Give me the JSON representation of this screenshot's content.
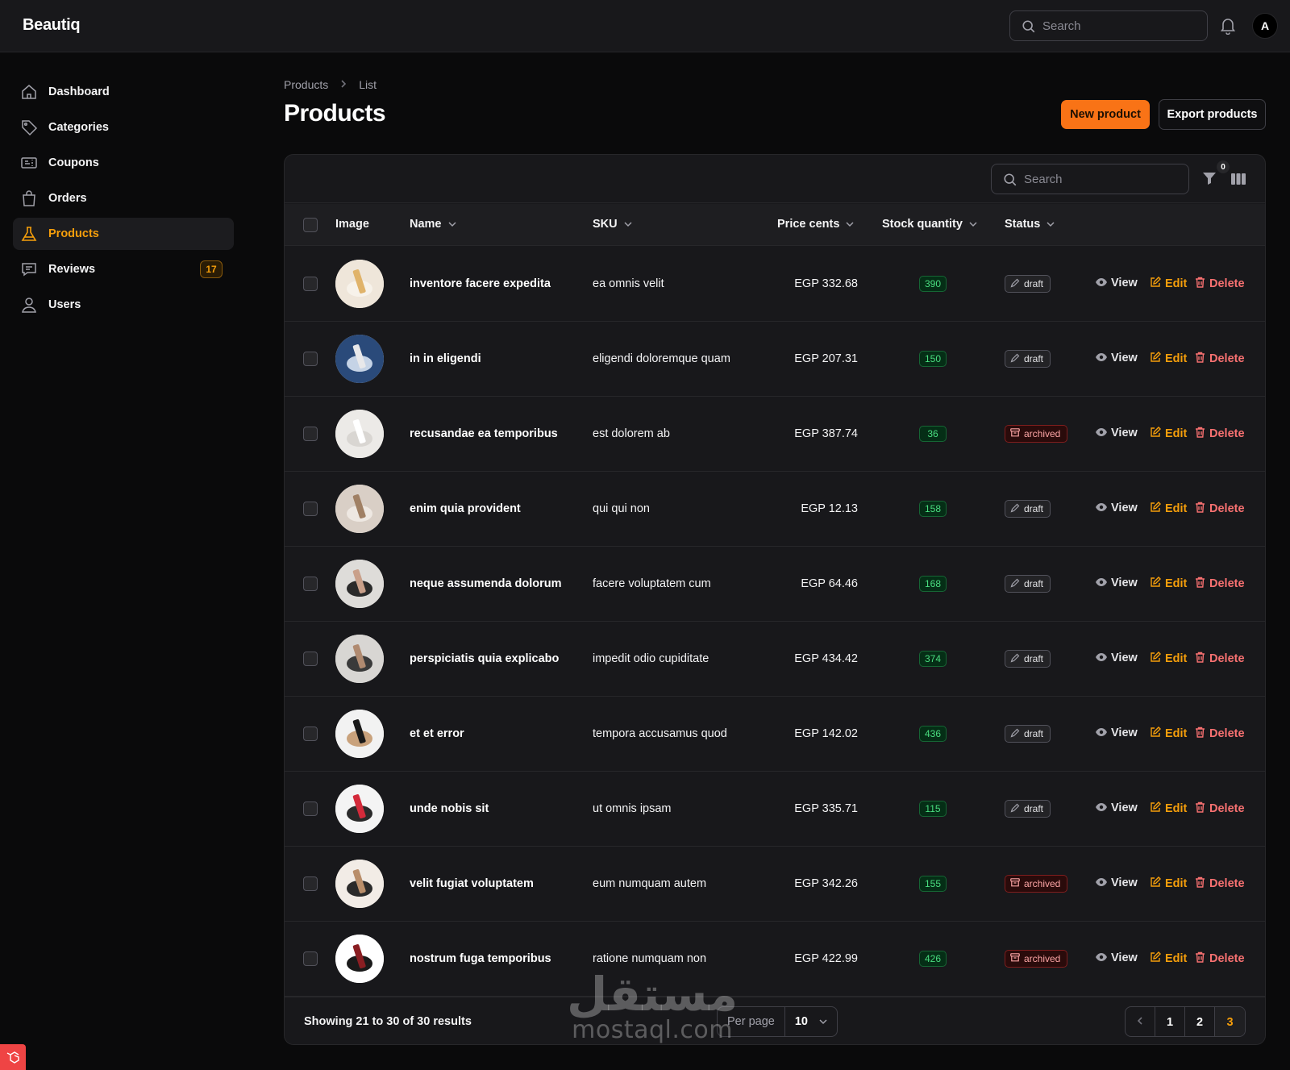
{
  "app": {
    "brand": "Beautiq"
  },
  "topbar": {
    "search_placeholder": "Search",
    "avatar_initial": "A"
  },
  "sidebar": {
    "items": [
      {
        "label": "Dashboard",
        "icon": "home-icon",
        "active": false
      },
      {
        "label": "Categories",
        "icon": "tag-icon",
        "active": false
      },
      {
        "label": "Coupons",
        "icon": "ticket-icon",
        "active": false
      },
      {
        "label": "Orders",
        "icon": "shopping-bag-icon",
        "active": false
      },
      {
        "label": "Products",
        "icon": "beaker-icon",
        "active": true
      },
      {
        "label": "Reviews",
        "icon": "chat-icon",
        "active": false,
        "badge": "17"
      },
      {
        "label": "Users",
        "icon": "user-icon",
        "active": false
      }
    ]
  },
  "header": {
    "breadcrumbs": [
      "Products",
      "List"
    ],
    "title": "Products",
    "new_button": "New product",
    "export_button": "Export products"
  },
  "table": {
    "search_placeholder": "Search",
    "filter_count": "0",
    "columns": {
      "image": "Image",
      "name": "Name",
      "sku": "SKU",
      "price": "Price cents",
      "stock": "Stock quantity",
      "status": "Status"
    },
    "actions": {
      "view": "View",
      "edit": "Edit",
      "delete": "Delete"
    },
    "rows": [
      {
        "name": "inventore facere expedita",
        "sku": "ea omnis velit",
        "price": "EGP 332.68",
        "stock": "390",
        "status": "draft"
      },
      {
        "name": "in in eligendi",
        "sku": "eligendi doloremque quam",
        "price": "EGP 207.31",
        "stock": "150",
        "status": "draft"
      },
      {
        "name": "recusandae ea temporibus",
        "sku": "est dolorem ab",
        "price": "EGP 387.74",
        "stock": "36",
        "status": "archived"
      },
      {
        "name": "enim quia provident",
        "sku": "qui qui non",
        "price": "EGP 12.13",
        "stock": "158",
        "status": "draft"
      },
      {
        "name": "neque assumenda dolorum",
        "sku": "facere voluptatem cum",
        "price": "EGP 64.46",
        "stock": "168",
        "status": "draft"
      },
      {
        "name": "perspiciatis quia explicabo",
        "sku": "impedit odio cupiditate",
        "price": "EGP 434.42",
        "stock": "374",
        "status": "draft"
      },
      {
        "name": "et et error",
        "sku": "tempora accusamus quod",
        "price": "EGP 142.02",
        "stock": "436",
        "status": "draft"
      },
      {
        "name": "unde nobis sit",
        "sku": "ut omnis ipsam",
        "price": "EGP 335.71",
        "stock": "115",
        "status": "draft"
      },
      {
        "name": "velit fugiat voluptatem",
        "sku": "eum numquam autem",
        "price": "EGP 342.26",
        "stock": "155",
        "status": "archived"
      },
      {
        "name": "nostrum fuga temporibus",
        "sku": "ratione numquam non",
        "price": "EGP 422.99",
        "stock": "426",
        "status": "archived"
      }
    ]
  },
  "footer": {
    "showing": "Showing 21 to 30 of 30 results",
    "per_page_label": "Per page",
    "per_page_value": "10",
    "pages": [
      "1",
      "2",
      "3"
    ],
    "current_page": "3"
  },
  "watermark": {
    "arabic": "مستقل",
    "latin": "mostaql.com"
  },
  "colors": {
    "accent": "#f59e0b",
    "primary_button": "#f97316",
    "stock_badge": "#4ade80",
    "archived_badge": "#fca5a5",
    "delete": "#f87171"
  }
}
